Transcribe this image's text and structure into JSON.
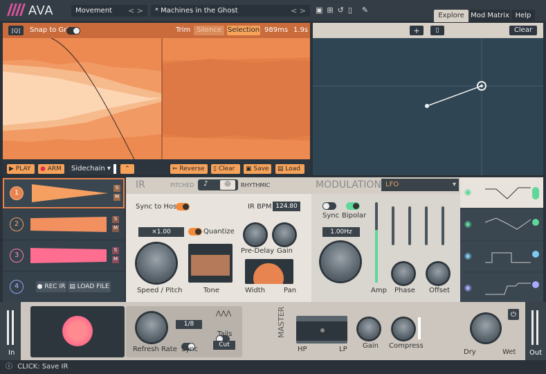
{
  "app": {
    "logo_text": "AVA"
  },
  "topbar": {
    "preset_category": "Movement",
    "preset_name": "* Machines in the Ghost"
  },
  "tabs": [
    {
      "label": "Explore",
      "active": true
    },
    {
      "label": "Mod Matrix",
      "active": false
    },
    {
      "label": "Help",
      "active": false
    }
  ],
  "wave_toolbar": {
    "snap_label": "Snap to Grid",
    "trim_label": "Trim",
    "silence_label": "Silence",
    "selection_label": "Selection",
    "time_ms": "989ms",
    "time_s": "1.9s"
  },
  "wave_footer": {
    "play": "PLAY",
    "arm": "ARM",
    "sidechain": "Sidechain",
    "reverse": "Reverse",
    "clear": "Clear",
    "save": "Save",
    "load": "Load"
  },
  "xy": {
    "clear": "Clear"
  },
  "tracks": [
    {
      "num": "1",
      "active": true
    },
    {
      "num": "2",
      "active": false
    },
    {
      "num": "3",
      "active": false
    },
    {
      "num": "4",
      "active": false
    }
  ],
  "track4": {
    "rec": "REC IR",
    "load": "LOAD FILE"
  },
  "ir": {
    "title": "IR",
    "pitched": "PITCHED",
    "rhythmic": "RHYTHMIC",
    "sync_host": "Sync to Host",
    "ir_bpm_label": "IR BPM",
    "ir_bpm_value": "124.80",
    "multiplier": "×1.00",
    "quantize": "Quantize",
    "speed_pitch": "Speed / Pitch",
    "tone": "Tone",
    "pre_delay": "Pre-Delay",
    "gain": "Gain",
    "width": "Width",
    "pan": "Pan"
  },
  "modulation": {
    "title": "MODULATION",
    "source": "LFO",
    "sync": "Sync",
    "bipolar": "Bipolar",
    "rate": "1.00Hz",
    "amp": "Amp",
    "phase": "Phase",
    "offset": "Offset"
  },
  "bottom": {
    "in": "In",
    "out": "Out",
    "refresh_rate": "Refresh Rate",
    "division": "1/8",
    "sync": "Sync",
    "tails": "Tails",
    "cut": "Cut",
    "master": "MASTER",
    "hp": "HP",
    "lp": "LP",
    "gain": "Gain",
    "compress": "Compress",
    "dry": "Dry",
    "wet": "Wet"
  },
  "status": {
    "text": "CLICK: Save IR"
  },
  "colors": {
    "accent_orange": "#e8844f",
    "accent_pink": "#ff6b8a",
    "lfo_green": "#5fd69a",
    "lfo_blue": "#7fc8f0"
  }
}
